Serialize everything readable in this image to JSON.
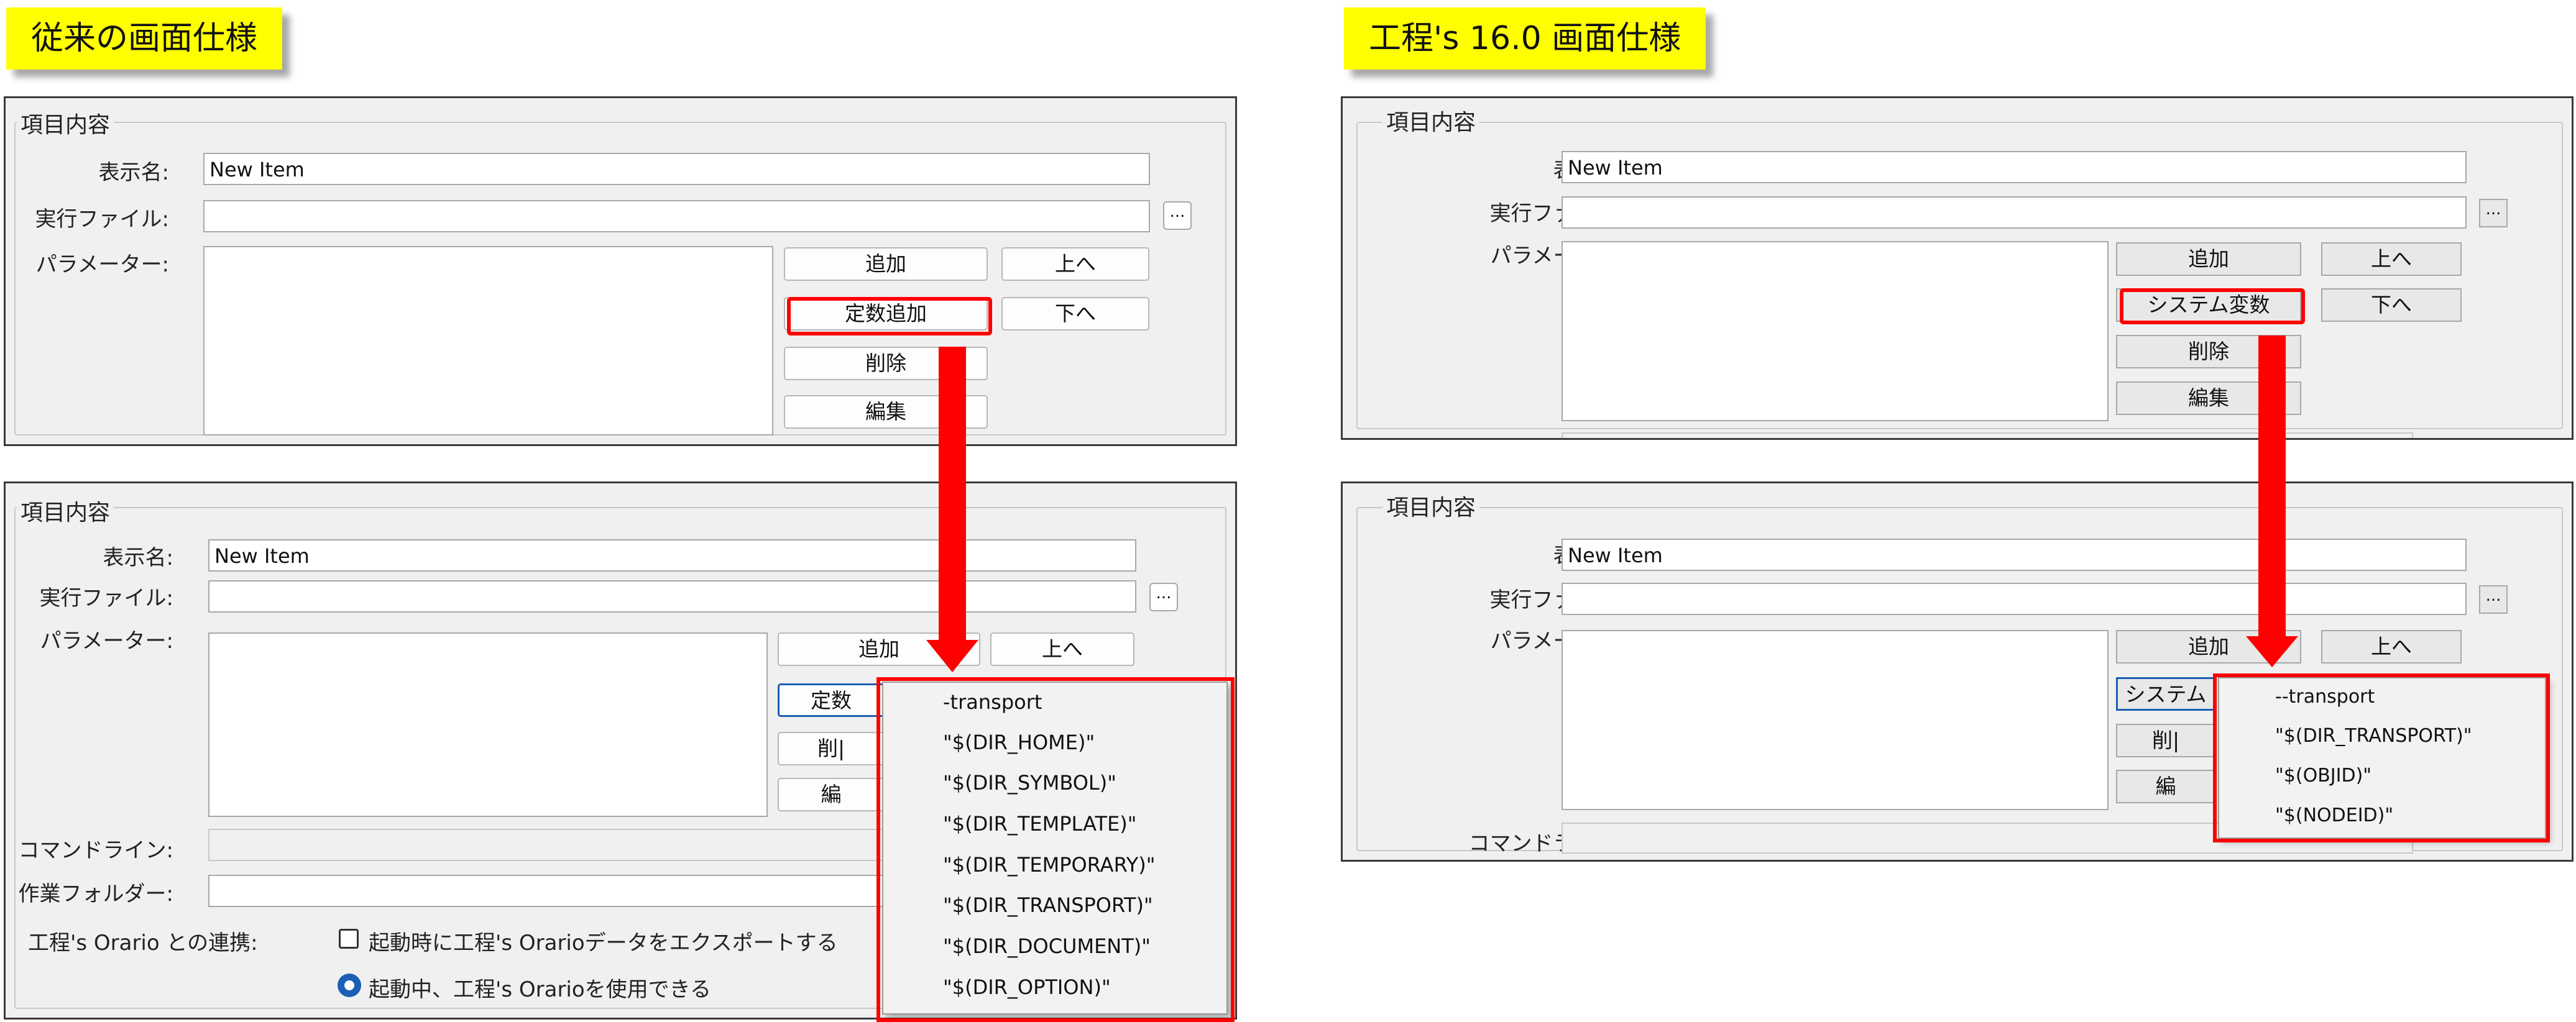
{
  "titles": {
    "legacy": "従来の画面仕様",
    "v16": "工程's 16.0 画面仕様"
  },
  "group_title": "項目内容",
  "labels": {
    "display_name": "表示名:",
    "exec_file": "実行ファイル:",
    "parameters": "パラメーター:",
    "command_line": "コマンドライン:",
    "work_folder": "作業フォルダー:",
    "orario_link": "工程's Orario との連携:"
  },
  "values": {
    "display_name": "New Item",
    "exec_file": ""
  },
  "buttons": {
    "add": "追加",
    "up": "上へ",
    "down": "下へ",
    "const_add": "定数追加",
    "sys_var": "システム変数",
    "delete": "削除",
    "edit": "編集",
    "browse": "...",
    "const_add_partial": "定数",
    "delete_partial": "削|",
    "edit_partial": "編",
    "sys_var_partial": "システム"
  },
  "options": {
    "export_on_start": "起動時に工程's Orarioデータをエクスポートする",
    "use_while_running": "起動中、工程's Orarioを使用できる"
  },
  "legacy_menu": [
    "-transport",
    "\"$(DIR_HOME)\"",
    "\"$(DIR_SYMBOL)\"",
    "\"$(DIR_TEMPLATE)\"",
    "\"$(DIR_TEMPORARY)\"",
    "\"$(DIR_TRANSPORT)\"",
    "\"$(DIR_DOCUMENT)\"",
    "\"$(DIR_OPTION)\""
  ],
  "v16_menu": [
    "--transport",
    "\"$(DIR_TRANSPORT)\"",
    "\"$(OBJID)\"",
    "\"$(NODEID)\""
  ],
  "colors": {
    "highlight": "#ff0000",
    "badge": "#ffff00",
    "accent": "#1a5fb4"
  }
}
